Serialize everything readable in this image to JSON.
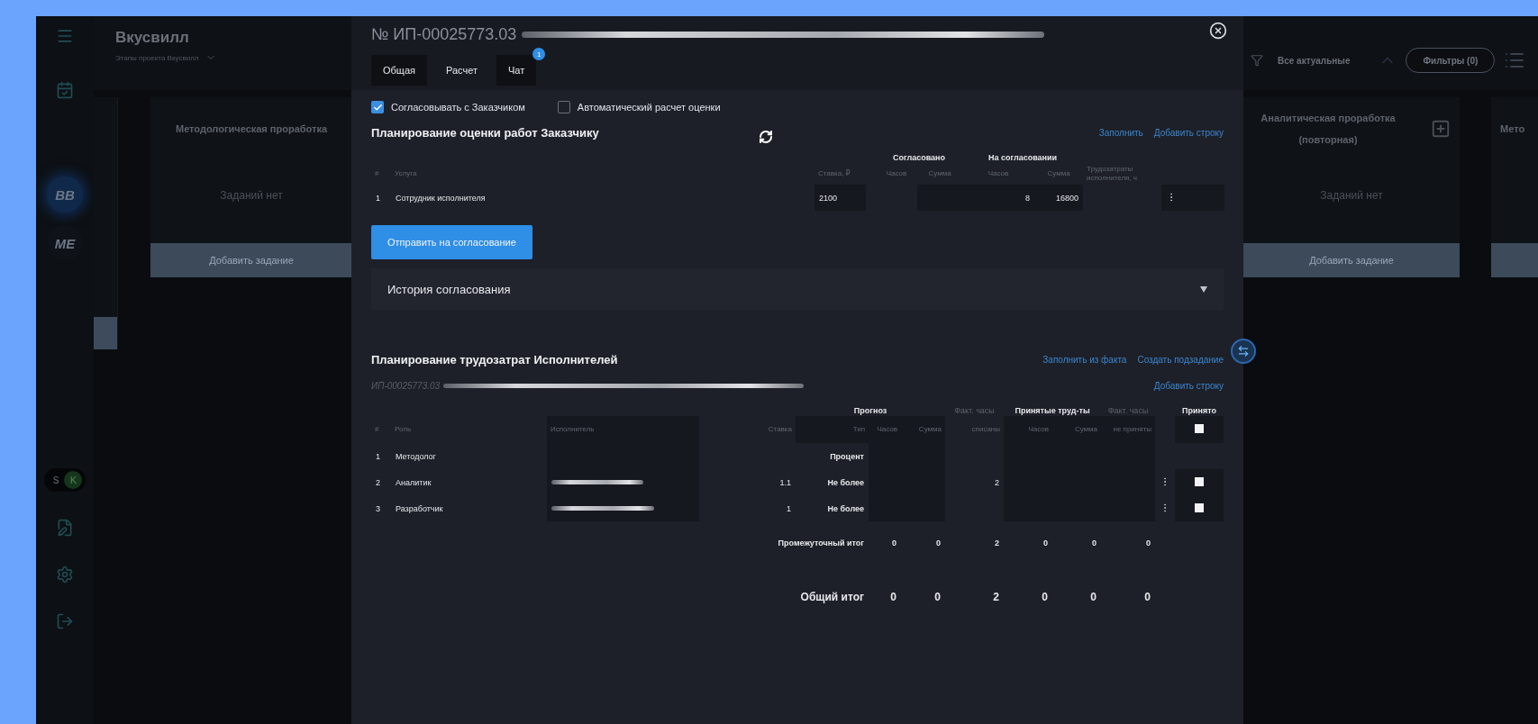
{
  "sidebar": {
    "avatars": [
      {
        "initials": "BB",
        "selected": true
      },
      {
        "initials": "ME",
        "selected": false
      }
    ],
    "status_pill": [
      "S",
      "K"
    ]
  },
  "project": {
    "title": "Вкусвилл",
    "subtitle": "Этапы проекта Вкусвилл"
  },
  "board": {
    "filter_label": "Все актуальные",
    "filters_button": "Фильтры (0)",
    "columns": [
      {
        "title": "Методологическая проработка",
        "empty_text": "Заданий нет",
        "add_button": "Добавить задание"
      },
      {
        "title": "Аналитическая проработка (повторная)",
        "empty_text": "Заданий нет",
        "add_button": "Добавить задание"
      },
      {
        "title": "Мето"
      }
    ]
  },
  "modal": {
    "title": "№ ИП-00025773.03",
    "tabs": [
      {
        "label": "Общая",
        "selected": false
      },
      {
        "label": "Расчет",
        "selected": true
      },
      {
        "label": "Чат",
        "selected": false,
        "badge": "1"
      }
    ],
    "options": [
      {
        "label": "Согласовывать с Заказчиком",
        "checked": true
      },
      {
        "label": "Автоматический расчет оценки",
        "checked": false
      }
    ],
    "customer_plan": {
      "title": "Планирование оценки работ Заказчику",
      "links": [
        "Заполнить",
        "Добавить строку"
      ],
      "groups": [
        "Согласовано",
        "На согласовании"
      ],
      "columns": [
        "#",
        "Услуга",
        "Ставка, ₽",
        "Часов",
        "Сумма",
        "Часов",
        "Сумма",
        "Трудозатраты исполнителя, ч"
      ],
      "rows": [
        {
          "cells": [
            "1",
            "Сотрудник исполнителя",
            "2100",
            null,
            null,
            "8",
            "16800",
            null
          ]
        }
      ],
      "send_button": "Отправить на согласование",
      "history": {
        "label": "История согласования",
        "expanded": false
      }
    },
    "executor_plan": {
      "title": "Планирование трудозатрат Исполнителей",
      "links": [
        "Заполнить из факта",
        "Создать подзадание"
      ],
      "subtitle": "ИП-00025773.03",
      "add_link": "Добавить строку",
      "groups": [
        "Прогноз",
        "Факт. часы",
        "Принятые труд-ты",
        "Факт. часы",
        "Принято"
      ],
      "columns": [
        "#",
        "Роль",
        "Исполнитель",
        "Ставка",
        "Тип",
        "Часов",
        "Сумма",
        "списаны",
        "Часов",
        "Сумма",
        "не приняты"
      ],
      "header_accepted": false,
      "rows": [
        {
          "cells": [
            "1",
            "Методолог",
            null,
            null,
            "Процент",
            null,
            null,
            null,
            null,
            null,
            null
          ],
          "executor_redacted": false
        },
        {
          "cells": [
            "2",
            "Аналитик",
            null,
            "1.1",
            "Не более",
            null,
            null,
            "2",
            null,
            null,
            null
          ],
          "executor_redacted": true,
          "accepted": false
        },
        {
          "cells": [
            "3",
            "Разработчик",
            null,
            "1",
            "Не более",
            null,
            null,
            null,
            null,
            null,
            null
          ],
          "executor_redacted": true,
          "accepted": false
        }
      ],
      "totals": [
        {
          "kind": "subtotal",
          "label": "Промежуточный итог",
          "values": [
            "0",
            "0",
            "2",
            "0",
            "0",
            "0"
          ]
        },
        {
          "kind": "total",
          "label": "Общий итог",
          "values": [
            "0",
            "0",
            "2",
            "0",
            "0",
            "0"
          ]
        }
      ]
    }
  }
}
